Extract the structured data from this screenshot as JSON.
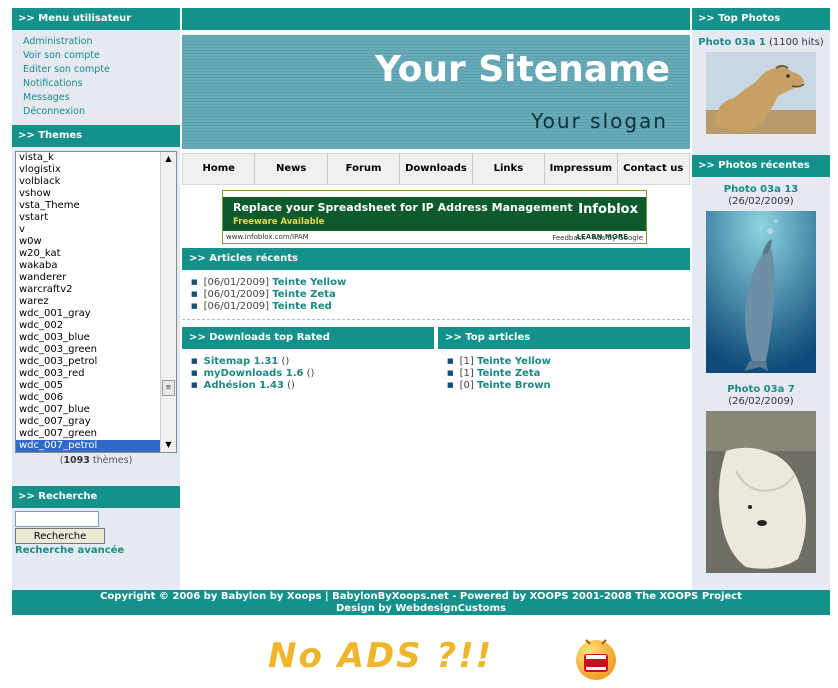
{
  "user_menu": {
    "title": ">> Menu utilisateur",
    "items": [
      "Administration",
      "Voir son compte",
      "Editer son compte",
      "Notifications",
      "Messages",
      "Déconnexion"
    ]
  },
  "themes": {
    "title": ">> Themes",
    "items": [
      "vista_k",
      "vlogistix",
      "volblack",
      "vshow",
      "vsta_Theme",
      "vstart",
      "v",
      "w0w",
      "w20_kat",
      "wakaba",
      "wanderer",
      "warcraftv2",
      "warez",
      "wdc_001_gray",
      "wdc_002",
      "wdc_003_blue",
      "wdc_003_green",
      "wdc_003_petrol",
      "wdc_003_red",
      "wdc_005",
      "wdc_006",
      "wdc_007_blue",
      "wdc_007_gray",
      "wdc_007_green",
      "wdc_007_petrol"
    ],
    "selected": "wdc_007_petrol",
    "count": "1093",
    "count_label": "thèmes"
  },
  "search": {
    "title": ">> Recherche",
    "input_value": "",
    "button_label": "Recherche",
    "advanced_label": "Recherche avancée"
  },
  "header": {
    "sitename": "Your Sitename",
    "slogan": "Your slogan"
  },
  "nav": [
    "Home",
    "News",
    "Forum",
    "Downloads",
    "Links",
    "Impressum",
    "Contact us"
  ],
  "ad": {
    "headline": "Replace your Spreadsheet for IP Address Management",
    "subline": "Freeware Available",
    "brand": "Infoblox",
    "url": "www.infoblox.com/IPAM",
    "learn_more": "LEARN MORE",
    "feedback": "Feedback - Ads by Google"
  },
  "recent_articles": {
    "title": ">> Articles récents",
    "items": [
      {
        "date": "[06/01/2009]",
        "title": "Teinte Yellow"
      },
      {
        "date": "[06/01/2009]",
        "title": "Teinte Zeta"
      },
      {
        "date": "[06/01/2009]",
        "title": "Teinte Red"
      }
    ]
  },
  "downloads_top": {
    "title": ">> Downloads top Rated",
    "items": [
      {
        "name": "Sitemap 1.31",
        "suffix": "()"
      },
      {
        "name": "myDownloads 1.6",
        "suffix": "()"
      },
      {
        "name": "Adhésion 1.43",
        "suffix": "()"
      }
    ]
  },
  "top_articles": {
    "title": ">> Top articles",
    "items": [
      {
        "count": "[1]",
        "title": "Teinte Yellow"
      },
      {
        "count": "[1]",
        "title": "Teinte Zeta"
      },
      {
        "count": "[0]",
        "title": "Teinte Brown"
      }
    ]
  },
  "top_photos": {
    "title": ">> Top Photos",
    "items": [
      {
        "name": "Photo 03a 1",
        "info": "(1100 hits)",
        "icon": "camel-photo"
      }
    ]
  },
  "recent_photos": {
    "title": ">> Photos récentes",
    "items": [
      {
        "name": "Photo 03a 13",
        "info": "(26/02/2009)",
        "icon": "dolphin-photo"
      },
      {
        "name": "Photo 03a 7",
        "info": "(26/02/2009)",
        "icon": "polar-bear-photo"
      }
    ]
  },
  "footer": {
    "line1": "Copyright © 2006 by Babylon by Xoops  |  BabylonByXoops.net - Powered by XOOPS 2001-2008 The XOOPS Project",
    "line2": "Design by WebdesignCustoms"
  },
  "no_ads_text": "No ADS ?!!",
  "colors": {
    "accent": "#14918a",
    "side_bg": "#e4e9f2",
    "link": "#1a8a84",
    "no_ads": "#f0b52a"
  }
}
